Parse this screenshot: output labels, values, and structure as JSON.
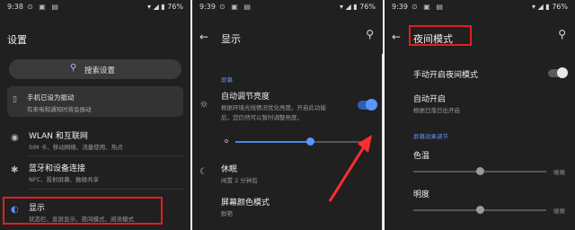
{
  "colors": {
    "accent": "#5b95ff",
    "panel_bg": "#202020",
    "highlight": "#e02020",
    "arrow": "#ff2d2d"
  },
  "status": {
    "p1_time": "9:38",
    "p2_time": "9:39",
    "p3_time": "9:39",
    "icons": "⊙ ▣ ▤",
    "right": "▾ ◢ ▮ 76%"
  },
  "settings_home": {
    "title": "设置",
    "search_placeholder": "搜索设置",
    "card": {
      "title": "手机已设为振动",
      "subtitle": "有来电和通知时将会振动"
    },
    "items": [
      {
        "icon": "wifi-icon",
        "glyph": "◉",
        "title": "WLAN 和互联网",
        "subtitle": "SIM 卡、移动网络、流量使用、热点"
      },
      {
        "icon": "bluetooth-icon",
        "glyph": "✱",
        "title": "蓝牙和设备连接",
        "subtitle": "NFC、投射屏幕、触碰共享"
      },
      {
        "icon": "display-icon",
        "glyph": "◐",
        "title": "显示",
        "subtitle": "状态栏、息屏显示、夜间模式、阅读模式"
      }
    ]
  },
  "display_page": {
    "back": "←",
    "title": "显示",
    "section": "屏幕",
    "auto_brightness": {
      "title": "自动调节亮度",
      "subtitle_line1": "根据环境光线情况优化亮度。开启此功能",
      "subtitle_line2": "后，您仍然可以暂时调整亮度。",
      "enabled": true
    },
    "brightness_level": 0.55,
    "sleep": {
      "title": "休眠",
      "subtitle": "闲置 2 分钟后"
    },
    "screen_color": {
      "title": "屏幕颜色模式",
      "subtitle": "鲜艳"
    }
  },
  "night_mode_page": {
    "back": "←",
    "title": "夜间模式",
    "manual_toggle": {
      "label": "手动开启夜间模式",
      "enabled": false
    },
    "auto_on": {
      "title": "自动开启",
      "subtitle": "根据日落日出开启"
    },
    "section": "屏幕效果调节",
    "color_temp": {
      "label": "色温",
      "right_label": "暖暖",
      "level": 0.5
    },
    "brightness": {
      "label": "明度",
      "right_label": "暖暖",
      "level": 0.5
    }
  }
}
